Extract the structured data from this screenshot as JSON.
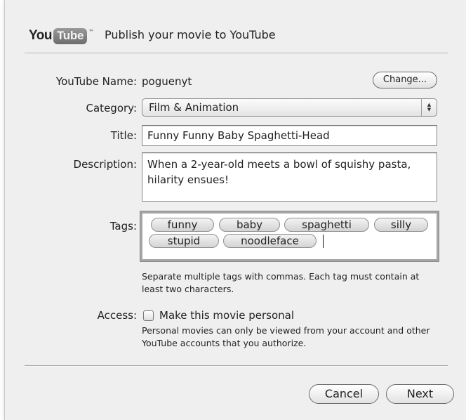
{
  "header": {
    "logo": {
      "you": "You",
      "tube": "Tube",
      "tm": "™"
    },
    "title": "Publish your movie to YouTube"
  },
  "form": {
    "youtube_name": {
      "label": "YouTube Name:",
      "value": "poguenyt",
      "change_button": "Change..."
    },
    "category": {
      "label": "Category:",
      "selected": "Film & Animation"
    },
    "title": {
      "label": "Title:",
      "value": "Funny Funny Baby Spaghetti-Head"
    },
    "description": {
      "label": "Description:",
      "value": "When a 2-year-old meets a bowl of squishy pasta, hilarity ensues!"
    },
    "tags": {
      "label": "Tags:",
      "items": [
        "funny",
        "baby",
        "spaghetti",
        "silly",
        "stupid",
        "noodleface"
      ],
      "help": "Separate multiple tags with commas. Each tag must contain at least two characters."
    },
    "access": {
      "label": "Access:",
      "checkbox_label": "Make this movie personal",
      "checked": false,
      "help": "Personal movies can only be viewed from your account and other YouTube accounts that you authorize."
    }
  },
  "footer": {
    "cancel_label": "Cancel",
    "next_label": "Next"
  }
}
